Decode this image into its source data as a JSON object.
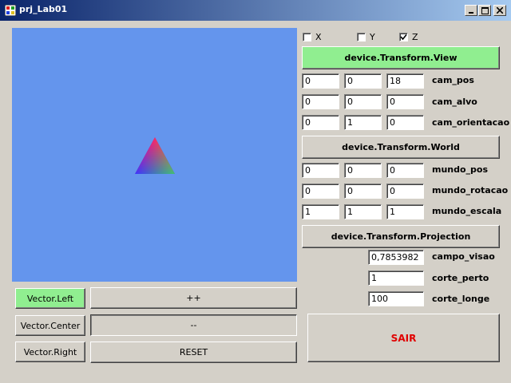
{
  "window": {
    "title": "prj_Lab01"
  },
  "checkboxes": [
    {
      "label": "X",
      "checked": false
    },
    {
      "label": "Y",
      "checked": false
    },
    {
      "label": "Z",
      "checked": true
    }
  ],
  "view": {
    "button": "device.Transform.View",
    "rows": [
      {
        "values": [
          "0",
          "0",
          "18"
        ],
        "label": "cam_pos"
      },
      {
        "values": [
          "0",
          "0",
          "0"
        ],
        "label": "cam_alvo"
      },
      {
        "values": [
          "0",
          "1",
          "0"
        ],
        "label": "cam_orientacao"
      }
    ]
  },
  "world": {
    "button": "device.Transform.World",
    "rows": [
      {
        "values": [
          "0",
          "0",
          "0"
        ],
        "label": "mundo_pos"
      },
      {
        "values": [
          "0",
          "0",
          "0"
        ],
        "label": "mundo_rotacao"
      },
      {
        "values": [
          "1",
          "1",
          "1"
        ],
        "label": "mundo_escala"
      }
    ]
  },
  "projection": {
    "button": "device.Transform.Projection",
    "rows": [
      {
        "value": "0,7853982",
        "label": "campo_visao"
      },
      {
        "value": "1",
        "label": "corte_perto"
      },
      {
        "value": "100",
        "label": "corte_longe"
      }
    ]
  },
  "vector_buttons": [
    "Vector.Left",
    "Vector.Center",
    "Vector.Right"
  ],
  "action_buttons": [
    "++",
    "--",
    "RESET"
  ],
  "exit_button": "SAIR",
  "colors": {
    "canvas": "#6495ED",
    "highlight": "#90EE90",
    "exit_text": "#E00000",
    "titlebar_start": "#0A246A",
    "titlebar_end": "#A6CAF0"
  }
}
